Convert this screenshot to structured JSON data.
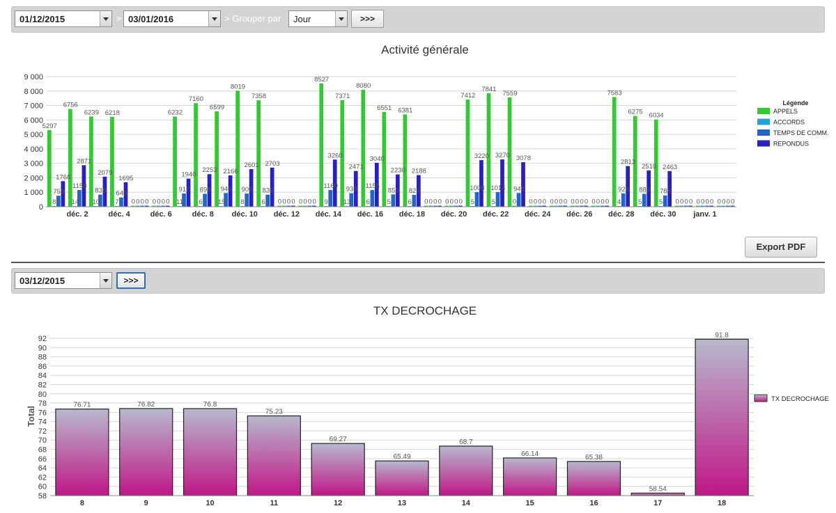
{
  "filter_bar": {
    "date_from": "01/12/2015",
    "separator": ">",
    "date_to": "03/01/2016",
    "group_label": "> Grouper par",
    "group_value": "Jour",
    "go_label": ">>>"
  },
  "export_pdf_label": "Export PDF",
  "day_bar": {
    "date": "03/12/2015",
    "go_label": ">>>"
  },
  "colors": {
    "appels": "#2ecc2e",
    "accords": "#21a3d6",
    "temps": "#2465c8",
    "repondus": "#2a1fbf",
    "tx_top": "#b7b9cd",
    "tx_bottom": "#c01787"
  },
  "chart_data": [
    {
      "type": "bar",
      "title": "Activité générale",
      "legend_title": "Légende",
      "legend_position": "right",
      "grid": true,
      "ylim": [
        0,
        9000
      ],
      "y_ticks": [
        "0",
        "1 000",
        "2 000",
        "3 000",
        "4 000",
        "5 000",
        "6 000",
        "7 000",
        "8 000",
        "9 000"
      ],
      "x_tick_labels": [
        "déc. 2",
        "déc. 4",
        "déc. 6",
        "déc. 8",
        "déc. 10",
        "déc. 12",
        "déc. 14",
        "déc. 16",
        "déc. 18",
        "déc. 20",
        "déc. 22",
        "déc. 24",
        "déc. 26",
        "déc. 28",
        "déc. 30",
        "janv. 1"
      ],
      "categories": [
        "déc. 1",
        "déc. 2",
        "déc. 3",
        "déc. 4",
        "déc. 5",
        "déc. 6",
        "déc. 7",
        "déc. 8",
        "déc. 9",
        "déc. 10",
        "déc. 11",
        "déc. 12",
        "déc. 13",
        "déc. 14",
        "déc. 15",
        "déc. 16",
        "déc. 17",
        "déc. 18",
        "déc. 19",
        "déc. 20",
        "déc. 21",
        "déc. 22",
        "déc. 23",
        "déc. 24",
        "déc. 25",
        "déc. 26",
        "déc. 27",
        "déc. 28",
        "déc. 29",
        "déc. 30",
        "déc. 31",
        "janv. 1",
        "janv. 2"
      ],
      "series": [
        {
          "name": "APPELS",
          "values": [
            5297,
            6756,
            6239,
            6218,
            0,
            0,
            6232,
            7160,
            6599,
            8019,
            7358,
            0,
            0,
            8527,
            7371,
            8080,
            6551,
            6381,
            0,
            0,
            7412,
            7841,
            7559,
            0,
            0,
            0,
            0,
            7583,
            6275,
            6034,
            0,
            0,
            0
          ]
        },
        {
          "name": "ACCORDS",
          "values": [
            8,
            14,
            10,
            7,
            0,
            0,
            11,
            6,
            15,
            8,
            6,
            0,
            0,
            9,
            13,
            6,
            5,
            6,
            0,
            0,
            5,
            5,
            0,
            0,
            0,
            0,
            0,
            4,
            5,
            5,
            0,
            0,
            0
          ]
        },
        {
          "name": "TEMPS DE COMM.",
          "values": [
            759,
            1158,
            838,
            640,
            0,
            0,
            917,
            898,
            946,
            909,
            832,
            0,
            0,
            1160,
            934,
            1155,
            853,
            820,
            0,
            0,
            1008,
            1014,
            948,
            0,
            0,
            0,
            0,
            923,
            889,
            784,
            0,
            0,
            0
          ]
        },
        {
          "name": "REPONDUS",
          "values": [
            1768,
            2871,
            2079,
            1695,
            0,
            0,
            1940,
            2253,
            2166,
            2601,
            2703,
            0,
            0,
            3260,
            2471,
            3040,
            2230,
            2188,
            0,
            0,
            3220,
            3270,
            3078,
            0,
            0,
            0,
            0,
            2813,
            2510,
            2463,
            0,
            0,
            0
          ]
        }
      ]
    },
    {
      "type": "bar",
      "title": "TX DECROCHAGE",
      "ylabel": "Total",
      "legend_position": "right",
      "grid": true,
      "ylim": [
        58,
        92
      ],
      "y_ticks": [
        "58",
        "60",
        "62",
        "64",
        "66",
        "68",
        "70",
        "72",
        "74",
        "76",
        "78",
        "80",
        "82",
        "84",
        "86",
        "88",
        "90",
        "92"
      ],
      "categories": [
        "8",
        "9",
        "10",
        "11",
        "12",
        "13",
        "14",
        "15",
        "16",
        "17",
        "18"
      ],
      "series": [
        {
          "name": "TX DECROCHAGE",
          "values": [
            76.71,
            76.82,
            76.8,
            75.23,
            69.27,
            65.49,
            68.7,
            66.14,
            65.38,
            58.54,
            91.8
          ]
        }
      ]
    }
  ]
}
